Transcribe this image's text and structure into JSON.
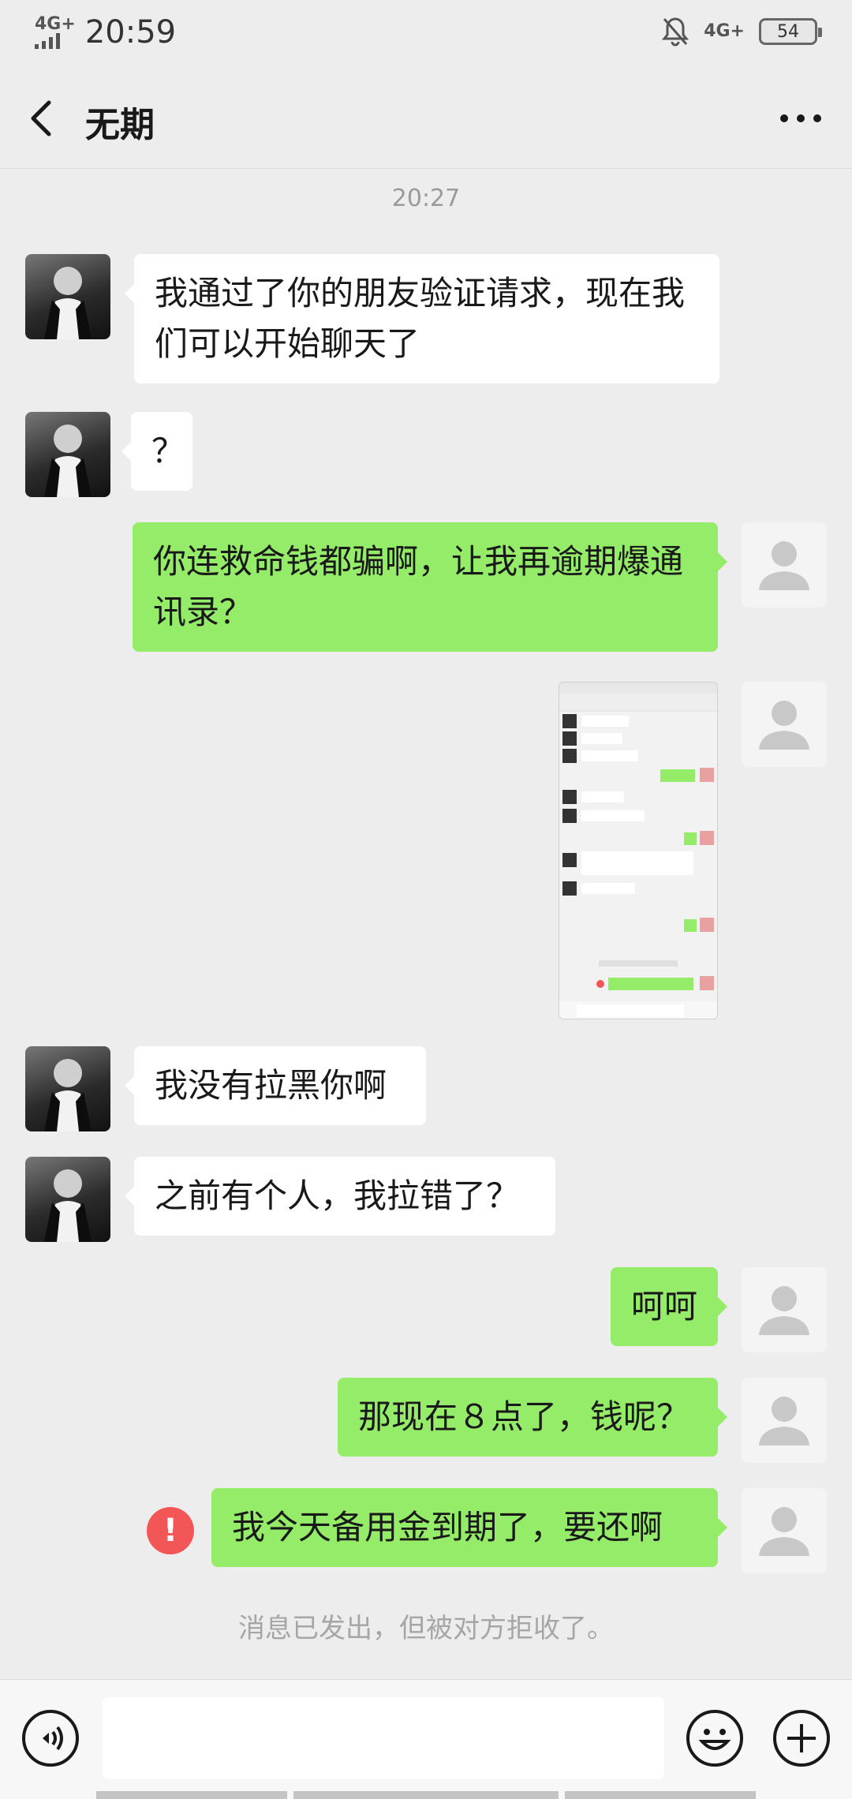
{
  "status": {
    "network": "4G+",
    "time": "20:59",
    "network_right": "4G+",
    "battery": "54"
  },
  "header": {
    "title": "无期"
  },
  "timestamp": "20:27",
  "messages": [
    {
      "side": "in",
      "text": "我通过了你的朋友验证请求，现在我们可以开始聊天了"
    },
    {
      "side": "in",
      "text": "？"
    },
    {
      "side": "out",
      "text": "你连救命钱都骗啊，让我再逾期爆通讯录？"
    },
    {
      "side": "out",
      "type": "image"
    },
    {
      "side": "in",
      "text": "我没有拉黑你啊"
    },
    {
      "side": "in",
      "text": "之前有个人，我拉错了？"
    },
    {
      "side": "out",
      "text": "呵呵"
    },
    {
      "side": "out",
      "text": "那现在８点了，钱呢？"
    },
    {
      "side": "out",
      "text": "我今天备用金到期了，要还啊",
      "failed": true
    }
  ],
  "error_mark": "!",
  "notice": "消息已发出，但被对方拒收了。"
}
